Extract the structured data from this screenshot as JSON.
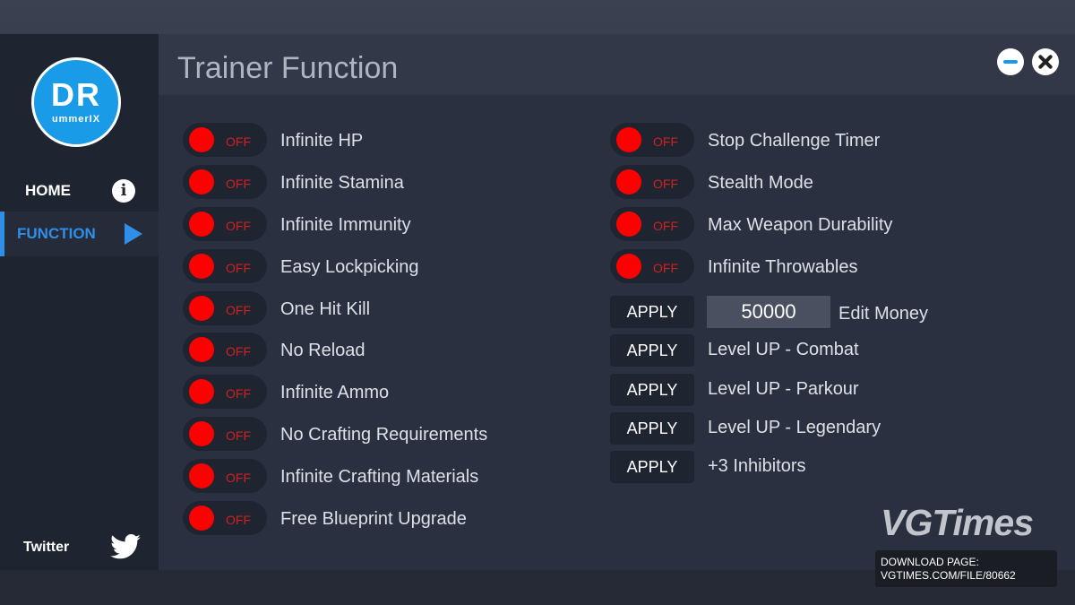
{
  "window": {
    "title": "Trainer Function"
  },
  "logo": {
    "big": "DR",
    "small": "ummerIX"
  },
  "sidebar": {
    "items": [
      {
        "label": "HOME",
        "icon": "info-icon"
      },
      {
        "label": "FUNCTION",
        "icon": "play-icon",
        "active": true
      }
    ],
    "social": {
      "label": "Twitter",
      "icon": "twitter-icon"
    }
  },
  "colors": {
    "accent": "#2f8fe8",
    "toggle_off": "#ff0000",
    "panel": "#2a3040",
    "sidebar": "#1f2431"
  },
  "left_column": [
    {
      "state": "OFF",
      "label": "Infinite HP"
    },
    {
      "state": "OFF",
      "label": "Infinite Stamina"
    },
    {
      "state": "OFF",
      "label": "Infinite Immunity"
    },
    {
      "state": "OFF",
      "label": "Easy Lockpicking"
    },
    {
      "state": "OFF",
      "label": "One Hit Kill"
    },
    {
      "state": "OFF",
      "label": "No Reload"
    },
    {
      "state": "OFF",
      "label": "Infinite Ammo"
    },
    {
      "state": "OFF",
      "label": "No Crafting Requirements"
    },
    {
      "state": "OFF",
      "label": "Infinite Crafting Materials"
    },
    {
      "state": "OFF",
      "label": "Free Blueprint Upgrade"
    }
  ],
  "right_toggles": [
    {
      "state": "OFF",
      "label": "Stop Challenge Timer"
    },
    {
      "state": "OFF",
      "label": "Stealth Mode"
    },
    {
      "state": "OFF",
      "label": "Max Weapon Durability"
    },
    {
      "state": "OFF",
      "label": "Infinite Throwables"
    }
  ],
  "money": {
    "button": "APPLY",
    "value": "50000",
    "label": "Edit Money"
  },
  "right_buttons": [
    {
      "button": "APPLY",
      "label": "Level UP - Combat"
    },
    {
      "button": "APPLY",
      "label": "Level UP - Parkour"
    },
    {
      "button": "APPLY",
      "label": "Level UP - Legendary"
    },
    {
      "button": "APPLY",
      "label": "+3 Inhibitors"
    }
  ],
  "watermark": {
    "brand": "VGTimes",
    "line1": "DOWNLOAD PAGE:",
    "line2": "VGTIMES.COM/FILE/80662"
  }
}
